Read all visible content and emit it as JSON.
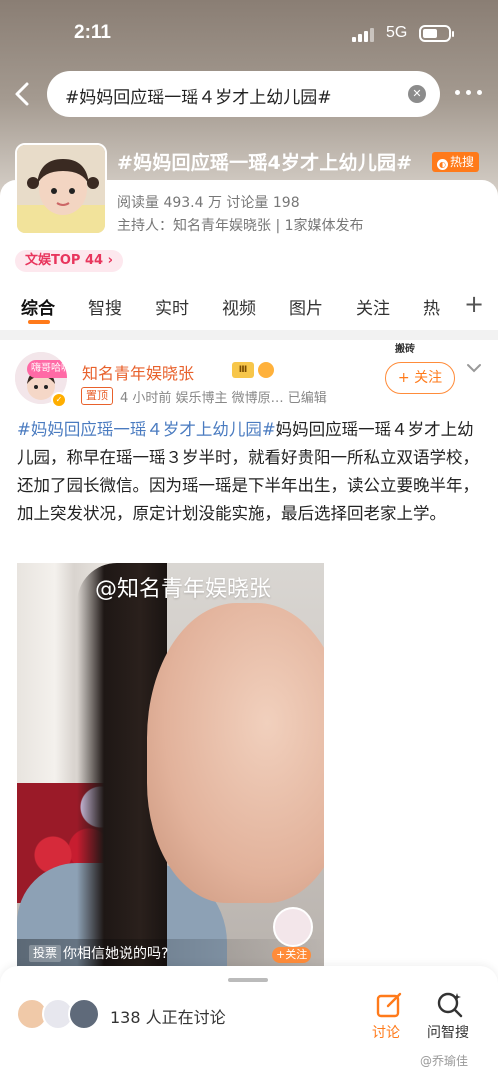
{
  "status_bar": {
    "time": "2:11",
    "network": "5G"
  },
  "search": {
    "query": "#妈妈回应瑶一瑶４岁才上幼儿园#"
  },
  "topic": {
    "title": "#妈妈回应瑶一瑶4岁才上幼儿园#",
    "hot_label": "热搜",
    "stats": "阅读量 493.4 万   讨论量 198",
    "host": "主持人：知名青年娱晓张 | 1家媒体发布",
    "rank_badge": "文娱TOP 44 ›"
  },
  "tabs": [
    "综合",
    "智搜",
    "实时",
    "视频",
    "图片",
    "关注",
    "热"
  ],
  "post": {
    "avatar_tag": "嗨哥哈嗨",
    "author": "知名青年娱晓张",
    "level": "Ⅲ",
    "pin": "置顶",
    "meta": "4 小时前   娱乐博主  微博原…  已编辑",
    "follow_label": "+ 关注",
    "follow_deco": "搬砖",
    "hashtag": "#妈妈回应瑶一瑶４岁才上幼儿园#",
    "text": "妈妈回应瑶一瑶４岁才上幼儿园，称早在瑶一瑶３岁半时，就看好贵阳一所私立双语学校，还加了园长微信。因为瑶一瑶是下半年出生，读公立要晚半年，加上突发状况，原定计划没能实施，最后选择回老家上学。",
    "video_watermark": "@知名青年娱晓张",
    "poll_label": "投票",
    "poll_question": "你相信她说的吗?",
    "mini_follow": "+关注"
  },
  "bottom": {
    "discussing": "138 人正在讨论",
    "discuss_label": "讨论",
    "ask_label": "问智搜"
  },
  "watermark": "@乔瑜佳",
  "colors": {
    "accent": "#ff7a1a",
    "hashtag": "#4a7bc0",
    "author": "#e8612c",
    "rank": "#e8365d"
  }
}
